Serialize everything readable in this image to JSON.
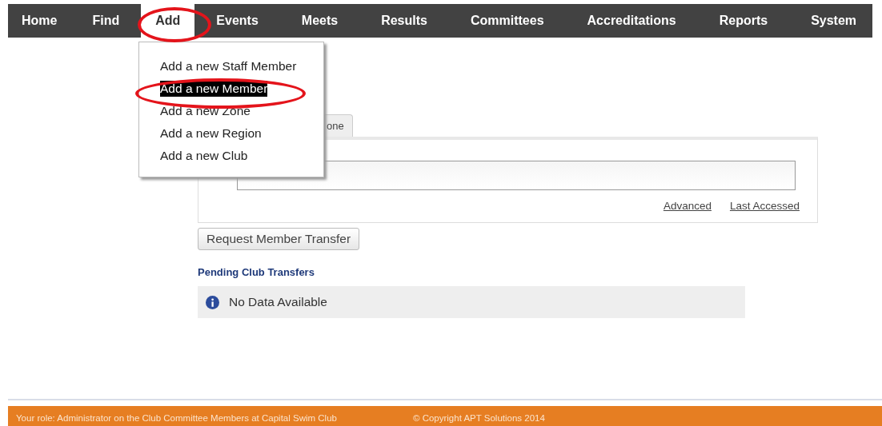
{
  "nav": [
    {
      "label": "Home",
      "selected": false
    },
    {
      "label": "Find",
      "selected": false
    },
    {
      "label": "Add",
      "selected": true
    },
    {
      "label": "Events",
      "selected": false
    },
    {
      "label": "Meets",
      "selected": false
    },
    {
      "label": "Results",
      "selected": false
    },
    {
      "label": "Committees",
      "selected": false
    },
    {
      "label": "Accreditations",
      "selected": false
    },
    {
      "label": "Reports",
      "selected": false
    },
    {
      "label": "System",
      "selected": false
    }
  ],
  "dropdown": [
    {
      "label": "Add a new Staff Member",
      "selected": false
    },
    {
      "label": "Add a new Member",
      "selected": true
    },
    {
      "label": "Add a new Zone",
      "selected": false
    },
    {
      "label": "Add a new Region",
      "selected": false
    },
    {
      "label": "Add a new Club",
      "selected": false
    }
  ],
  "tab": {
    "label": "one",
    "selected": true
  },
  "search": {
    "links": [
      "Advanced",
      "Last Accessed"
    ]
  },
  "transfer_button": "Request Member Transfer",
  "pending": {
    "title": "Pending Club Transfers",
    "message": "No Data Available"
  },
  "footer": {
    "role": "Your role: Administrator on the Club Committee Members at Capital Swim Club",
    "copyright": "© Copyright APT Solutions 2014"
  }
}
